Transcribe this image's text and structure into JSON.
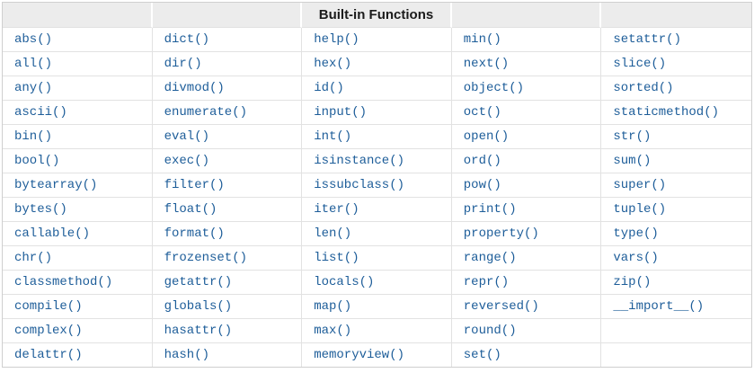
{
  "table": {
    "title": "Built-in Functions",
    "column_count": 5,
    "colors": {
      "link": "#1d5d99",
      "header_bg": "#ececec",
      "border": "#e2e2e2",
      "outer_border": "#cfcfcf",
      "header_text": "#1b1b1b"
    },
    "rows": [
      [
        "abs()",
        "dict()",
        "help()",
        "min()",
        "setattr()"
      ],
      [
        "all()",
        "dir()",
        "hex()",
        "next()",
        "slice()"
      ],
      [
        "any()",
        "divmod()",
        "id()",
        "object()",
        "sorted()"
      ],
      [
        "ascii()",
        "enumerate()",
        "input()",
        "oct()",
        "staticmethod()"
      ],
      [
        "bin()",
        "eval()",
        "int()",
        "open()",
        "str()"
      ],
      [
        "bool()",
        "exec()",
        "isinstance()",
        "ord()",
        "sum()"
      ],
      [
        "bytearray()",
        "filter()",
        "issubclass()",
        "pow()",
        "super()"
      ],
      [
        "bytes()",
        "float()",
        "iter()",
        "print()",
        "tuple()"
      ],
      [
        "callable()",
        "format()",
        "len()",
        "property()",
        "type()"
      ],
      [
        "chr()",
        "frozenset()",
        "list()",
        "range()",
        "vars()"
      ],
      [
        "classmethod()",
        "getattr()",
        "locals()",
        "repr()",
        "zip()"
      ],
      [
        "compile()",
        "globals()",
        "map()",
        "reversed()",
        "__import__()"
      ],
      [
        "complex()",
        "hasattr()",
        "max()",
        "round()",
        ""
      ],
      [
        "delattr()",
        "hash()",
        "memoryview()",
        "set()",
        ""
      ]
    ]
  }
}
